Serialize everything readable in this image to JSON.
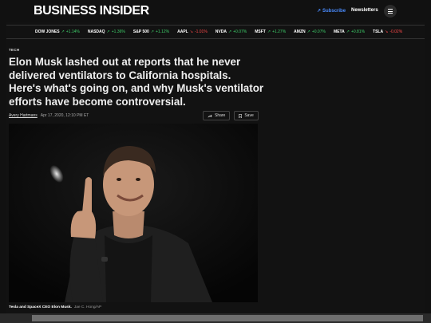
{
  "header": {
    "logo": "BUSINESS INSIDER",
    "subscribe_label": "Subscribe",
    "newsletters_label": "Newsletters"
  },
  "ticker": [
    {
      "name": "DOW JONES",
      "change": "+1.14%",
      "direction": "up"
    },
    {
      "name": "NASDAQ",
      "change": "+1.36%",
      "direction": "up"
    },
    {
      "name": "S&P 500",
      "change": "+1.12%",
      "direction": "up"
    },
    {
      "name": "AAPL",
      "change": "-1.01%",
      "direction": "down"
    },
    {
      "name": "NVDA",
      "change": "+0.07%",
      "direction": "up"
    },
    {
      "name": "MSFT",
      "change": "+1.27%",
      "direction": "up"
    },
    {
      "name": "AMZN",
      "change": "+0.07%",
      "direction": "up"
    },
    {
      "name": "META",
      "change": "+0.81%",
      "direction": "up"
    },
    {
      "name": "TSLA",
      "change": "-0.02%",
      "direction": "down"
    }
  ],
  "article": {
    "section": "TECH",
    "headline": "Elon Musk lashed out at reports that he never delivered ventilators to California hospitals. Here's what's going on, and why Musk's ventilator efforts have become controversial.",
    "author": "Avery Hartmans",
    "date": "Apr 17, 2020, 12:10 PM ET",
    "share_label": "Share",
    "save_label": "Save",
    "caption": "Tesla and SpaceX CEO Elon Musk.",
    "credit": "Jae C. Hong/AP"
  },
  "colors": {
    "accent": "#4a8cff",
    "up": "#3ecf6a",
    "down": "#ff4a4a"
  }
}
